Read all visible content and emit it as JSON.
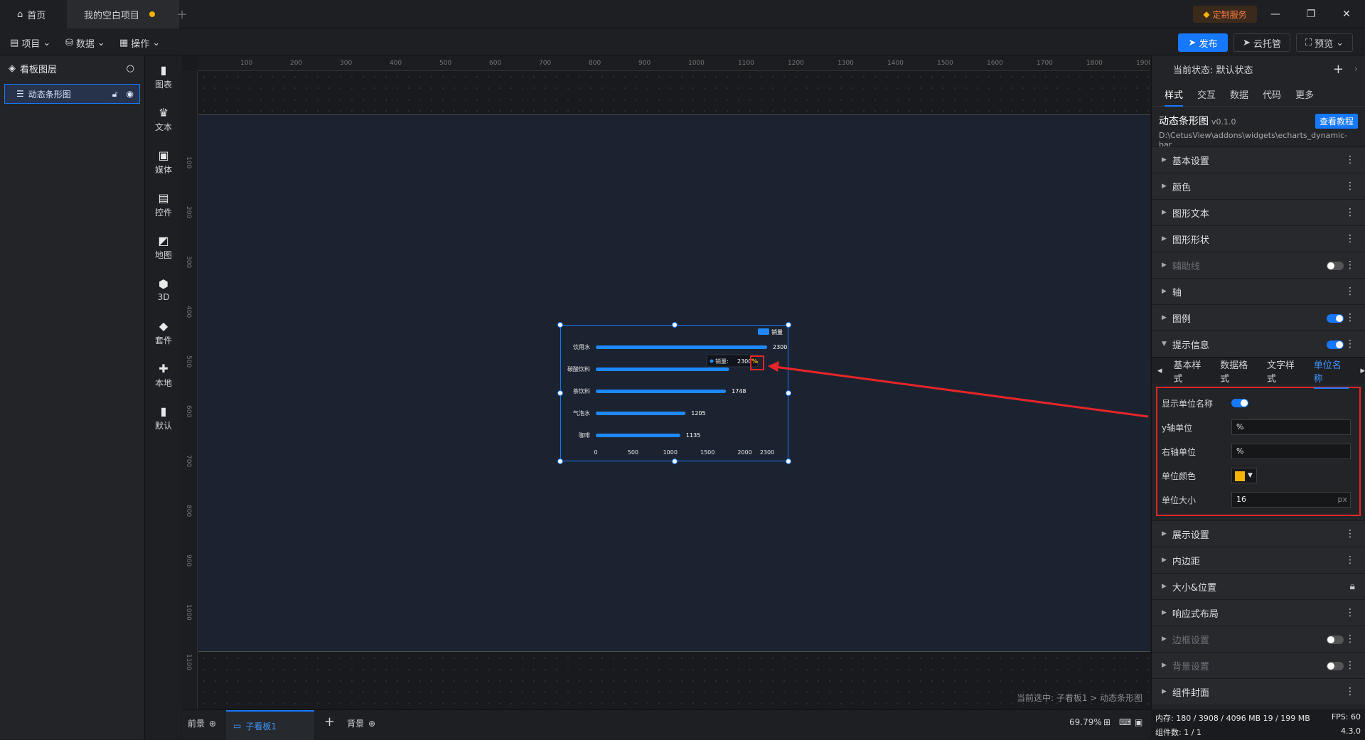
{
  "titlebar": {
    "home": "首页",
    "project": "我的空白项目",
    "custom_service": "定制服务"
  },
  "menubar": {
    "project": "项目",
    "data": "数据",
    "operate": "操作",
    "publish": "发布",
    "cloud": "云托管",
    "preview": "预览"
  },
  "layers": {
    "title": "看板图层",
    "item": "动态条形图"
  },
  "tools": [
    {
      "label": "图表",
      "icon": "▮"
    },
    {
      "label": "文本",
      "icon": "♛"
    },
    {
      "label": "媒体",
      "icon": "▣"
    },
    {
      "label": "控件",
      "icon": "▤"
    },
    {
      "label": "地图",
      "icon": "◩"
    },
    {
      "label": "3D",
      "icon": "⬢"
    },
    {
      "label": "套件",
      "icon": "◆"
    },
    {
      "label": "本地",
      "icon": "✚"
    },
    {
      "label": "默认",
      "icon": "▮"
    }
  ],
  "ruler": {
    "top": [
      "100",
      "200",
      "300",
      "400",
      "500",
      "600",
      "700",
      "800",
      "900",
      "1000",
      "1100",
      "1200",
      "1300",
      "1400",
      "1500",
      "1600",
      "1700",
      "1800",
      "1900"
    ],
    "left": [
      "100",
      "200",
      "300",
      "400",
      "500",
      "600",
      "700",
      "800",
      "900",
      "1000",
      "1100"
    ]
  },
  "chart_data": {
    "type": "bar",
    "categories": [
      "饮用水",
      "碳酸饮料",
      "茶饮料",
      "气泡水",
      "咖啡"
    ],
    "series": [
      {
        "name": "销量",
        "values": [
          2300,
          1790,
          1748,
          1205,
          1135
        ]
      }
    ],
    "value_labels": [
      "2300",
      "",
      "1748",
      "1205",
      "1135"
    ],
    "xticks": [
      "0",
      "500",
      "1000",
      "1500",
      "2000",
      "2300"
    ],
    "xlim": [
      0,
      2300
    ],
    "tooltip": {
      "label": "销量:",
      "value": "2300",
      "unit": "%"
    },
    "color": "#1e88ff"
  },
  "status_path": "当前选中: 子看板1 > 动态条形图",
  "bottombar": {
    "front": "前景",
    "sub": "子看板1",
    "back": "背景",
    "zoom": "69.79%"
  },
  "panel": {
    "state": "当前状态: 默认状态",
    "tabs": [
      "样式",
      "交互",
      "数据",
      "代码",
      "更多"
    ],
    "widget_name": "动态条形图",
    "version": "v0.1.0",
    "path": "D:\\CetusView\\addons\\widgets\\echarts_dynamic-bar",
    "tutorial": "查看教程",
    "sections_top": [
      "基本设置",
      "颜色",
      "图形文本",
      "图形形状",
      "辅助线",
      "轴",
      "图例",
      "提示信息"
    ],
    "subtabs": [
      "基本样式",
      "数据格式",
      "文字样式",
      "单位名称"
    ],
    "unit": {
      "show_label": "显示单位名称",
      "y_label": "y轴单位",
      "y_value": "%",
      "right_label": "右轴单位",
      "right_value": "%",
      "color_label": "单位颜色",
      "size_label": "单位大小",
      "size_value": "16",
      "size_unit": "px"
    },
    "sections_bottom": [
      "展示设置",
      "内边距",
      "大小&位置",
      "响应式布局",
      "边框设置",
      "背景设置",
      "组件封面"
    ]
  },
  "memory": {
    "mem": "内存: 180 / 3908 / 4096 MB 19 / 199 MB",
    "fps": "FPS: 60",
    "count": "组件数: 1 / 1",
    "version": "4.3.0"
  },
  "accent": "#1677ff",
  "warn": "#f5b400",
  "annot": "#e5252a"
}
